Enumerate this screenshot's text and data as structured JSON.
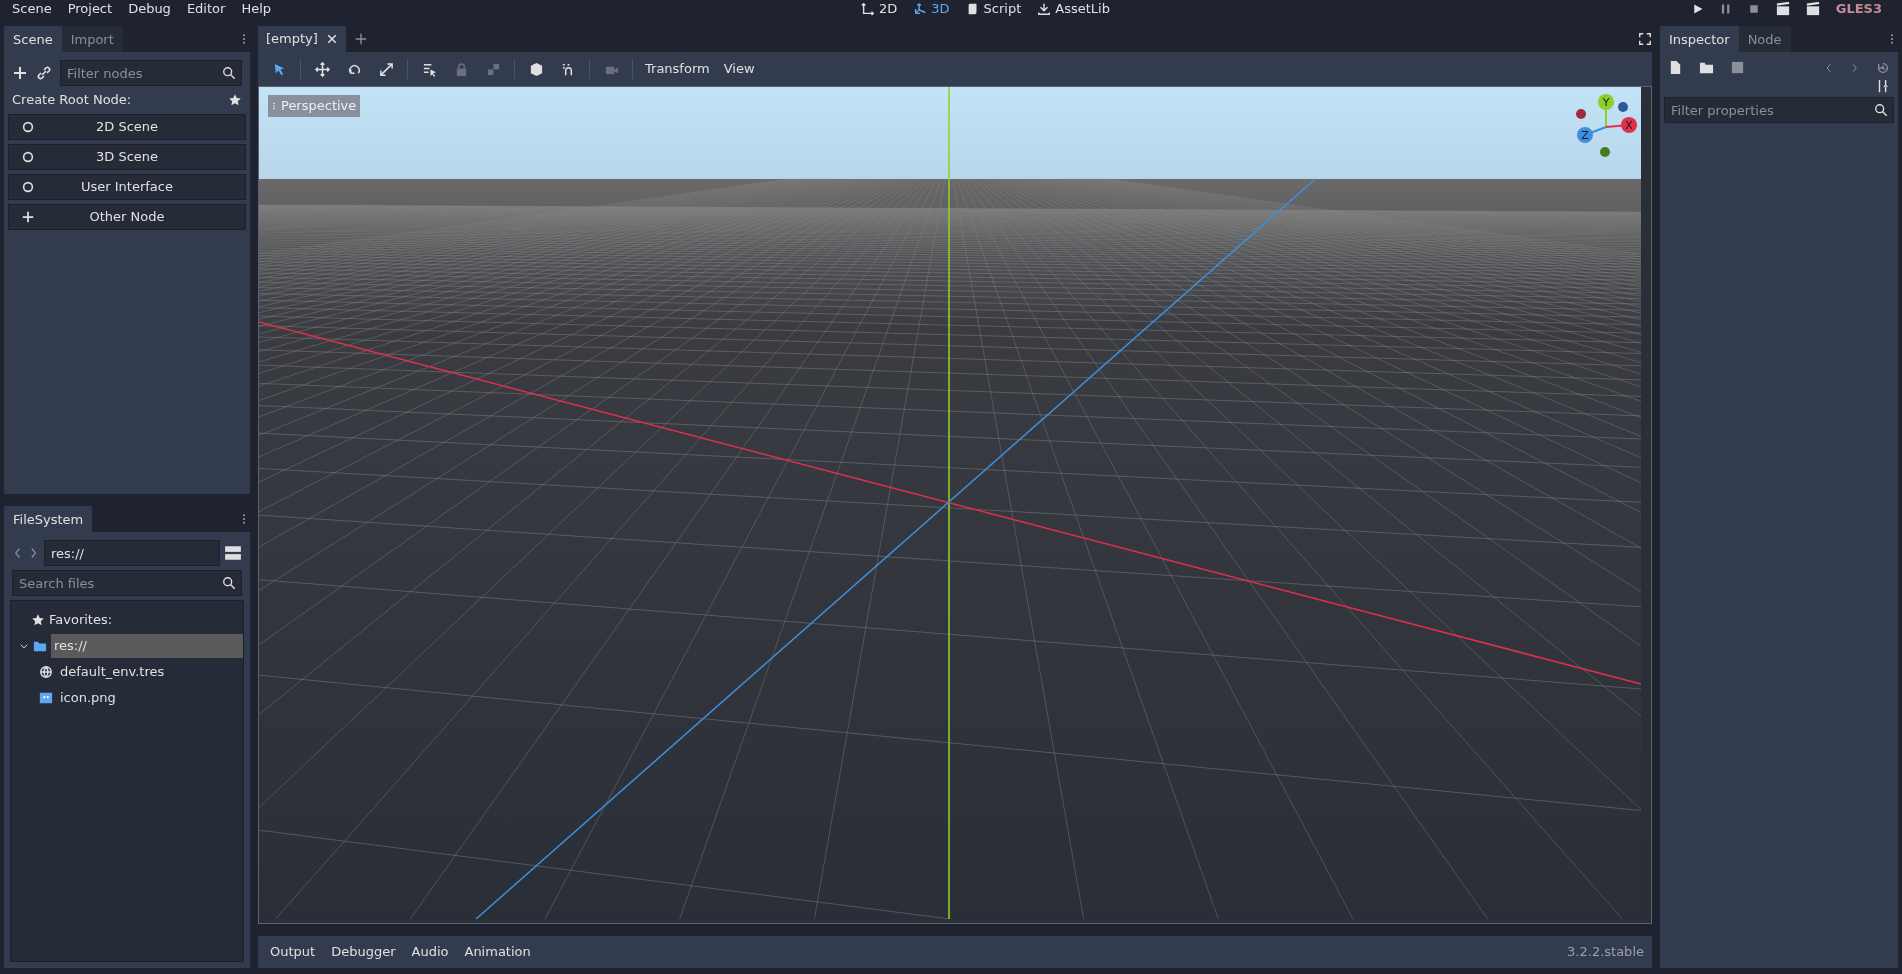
{
  "menu_bar": [
    "Scene",
    "Project",
    "Debug",
    "Editor",
    "Help"
  ],
  "main_screens": [
    {
      "label": "2D",
      "kind": "planar",
      "selected": false
    },
    {
      "label": "3D",
      "kind": "spatial",
      "selected": true
    },
    {
      "label": "Script",
      "kind": "script",
      "selected": false
    },
    {
      "label": "AssetLib",
      "kind": "assetlib",
      "selected": false
    }
  ],
  "renderer": "GLES3",
  "scene_dock": {
    "tabs": [
      {
        "label": "Scene",
        "selected": true
      },
      {
        "label": "Import",
        "selected": false
      }
    ],
    "filter": {
      "placeholder": "Filter nodes"
    },
    "create_root_label": "Create Root Node:",
    "root_options": [
      {
        "label": "2D Scene",
        "kind": "circle"
      },
      {
        "label": "3D Scene",
        "kind": "circle"
      },
      {
        "label": "User Interface",
        "kind": "circle"
      },
      {
        "label": "Other Node",
        "kind": "plus"
      }
    ]
  },
  "filesystem_dock": {
    "tabs": [
      {
        "label": "FileSystem",
        "selected": true
      }
    ],
    "path": "res://",
    "search": {
      "placeholder": "Search files"
    },
    "favorites_label": "Favorites:",
    "tree": [
      {
        "label": "res://",
        "kind": "folder",
        "selected": true,
        "expanded": true,
        "children": [
          {
            "label": "default_env.tres",
            "kind": "environment",
            "selected": false
          },
          {
            "label": "icon.png",
            "kind": "image",
            "selected": false
          }
        ]
      }
    ]
  },
  "editor_tabs": [
    {
      "label": "[empty]",
      "selected": true
    }
  ],
  "toolbar": {
    "tools": [
      {
        "kind": "select",
        "selected": true,
        "disabled": false
      },
      {
        "kind": "move",
        "selected": false,
        "disabled": false
      },
      {
        "kind": "rotate",
        "selected": false,
        "disabled": false
      },
      {
        "kind": "scale",
        "selected": false,
        "disabled": false
      },
      {
        "kind": "list-select",
        "selected": false,
        "disabled": false
      },
      {
        "kind": "lock",
        "selected": false,
        "disabled": true
      },
      {
        "kind": "group",
        "selected": false,
        "disabled": true
      },
      {
        "kind": "local",
        "selected": false,
        "disabled": false
      },
      {
        "kind": "snap",
        "selected": false,
        "disabled": false
      },
      {
        "kind": "camera",
        "selected": false,
        "disabled": true
      }
    ],
    "menus": [
      "Transform",
      "View"
    ]
  },
  "viewport": {
    "label": "Perspective",
    "gizmo_axes": [
      "Y",
      "X",
      "Z"
    ]
  },
  "inspector_dock": {
    "tabs": [
      {
        "label": "Inspector",
        "selected": true
      },
      {
        "label": "Node",
        "selected": false
      }
    ],
    "filter": {
      "placeholder": "Filter properties"
    }
  },
  "bottom_panel": {
    "tabs": [
      "Output",
      "Debugger",
      "Audio",
      "Animation"
    ],
    "version": "3.2.2.stable"
  }
}
